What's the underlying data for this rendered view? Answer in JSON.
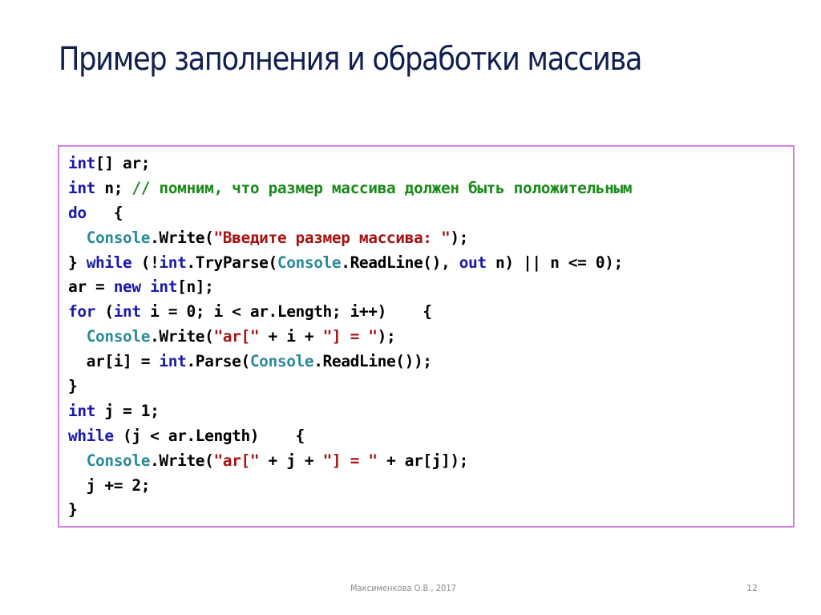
{
  "slide": {
    "title": "Пример заполнения и обработки массива",
    "accent_colors": {
      "title": "#0f1f4f",
      "frame_border": "#cf84d8",
      "keyword": "#1a1aa8",
      "type": "#2b8a9a",
      "string": "#a31515",
      "comment": "#1a8a1a"
    },
    "code_lines": [
      [
        {
          "t": "kw",
          "v": "int"
        },
        {
          "t": "plain",
          "v": "[] ar;"
        }
      ],
      [
        {
          "t": "kw",
          "v": "int"
        },
        {
          "t": "plain",
          "v": " n; "
        },
        {
          "t": "cm",
          "v": "// помним, что размер массива должен быть положительным"
        }
      ],
      [
        {
          "t": "kw",
          "v": "do"
        },
        {
          "t": "plain",
          "v": "   {"
        }
      ],
      [
        {
          "t": "plain",
          "v": "  "
        },
        {
          "t": "type",
          "v": "Console"
        },
        {
          "t": "plain",
          "v": ".Write("
        },
        {
          "t": "str",
          "v": "\"Введите размер массива: \""
        },
        {
          "t": "plain",
          "v": ");"
        }
      ],
      [
        {
          "t": "plain",
          "v": "} "
        },
        {
          "t": "kw",
          "v": "while"
        },
        {
          "t": "plain",
          "v": " (!"
        },
        {
          "t": "kw",
          "v": "int"
        },
        {
          "t": "plain",
          "v": ".TryParse("
        },
        {
          "t": "type",
          "v": "Console"
        },
        {
          "t": "plain",
          "v": ".ReadLine(), "
        },
        {
          "t": "kw",
          "v": "out"
        },
        {
          "t": "plain",
          "v": " n) || n <= 0);"
        }
      ],
      [
        {
          "t": "plain",
          "v": "ar = "
        },
        {
          "t": "kw",
          "v": "new"
        },
        {
          "t": "plain",
          "v": " "
        },
        {
          "t": "kw",
          "v": "int"
        },
        {
          "t": "plain",
          "v": "[n];"
        }
      ],
      [
        {
          "t": "kw",
          "v": "for"
        },
        {
          "t": "plain",
          "v": " ("
        },
        {
          "t": "kw",
          "v": "int"
        },
        {
          "t": "plain",
          "v": " i = 0; i < ar.Length; i++)    {"
        }
      ],
      [
        {
          "t": "plain",
          "v": "  "
        },
        {
          "t": "type",
          "v": "Console"
        },
        {
          "t": "plain",
          "v": ".Write("
        },
        {
          "t": "str",
          "v": "\"ar[\""
        },
        {
          "t": "plain",
          "v": " + i + "
        },
        {
          "t": "str",
          "v": "\"] = \""
        },
        {
          "t": "plain",
          "v": ");"
        }
      ],
      [
        {
          "t": "plain",
          "v": "  ar[i] = "
        },
        {
          "t": "kw",
          "v": "int"
        },
        {
          "t": "plain",
          "v": ".Parse("
        },
        {
          "t": "type",
          "v": "Console"
        },
        {
          "t": "plain",
          "v": ".ReadLine());"
        }
      ],
      [
        {
          "t": "plain",
          "v": "}"
        }
      ],
      [
        {
          "t": "kw",
          "v": "int"
        },
        {
          "t": "plain",
          "v": " j = 1;"
        }
      ],
      [
        {
          "t": "kw",
          "v": "while"
        },
        {
          "t": "plain",
          "v": " (j < ar.Length)    {"
        }
      ],
      [
        {
          "t": "plain",
          "v": "  "
        },
        {
          "t": "type",
          "v": "Console"
        },
        {
          "t": "plain",
          "v": ".Write("
        },
        {
          "t": "str",
          "v": "\"ar[\""
        },
        {
          "t": "plain",
          "v": " + j + "
        },
        {
          "t": "str",
          "v": "\"] = \""
        },
        {
          "t": "plain",
          "v": " + ar[j]);"
        }
      ],
      [
        {
          "t": "plain",
          "v": "  j += 2;"
        }
      ],
      [
        {
          "t": "plain",
          "v": "}"
        }
      ]
    ]
  },
  "footer": {
    "author": "Максименкова О.В., 2017",
    "page_number": "12"
  }
}
